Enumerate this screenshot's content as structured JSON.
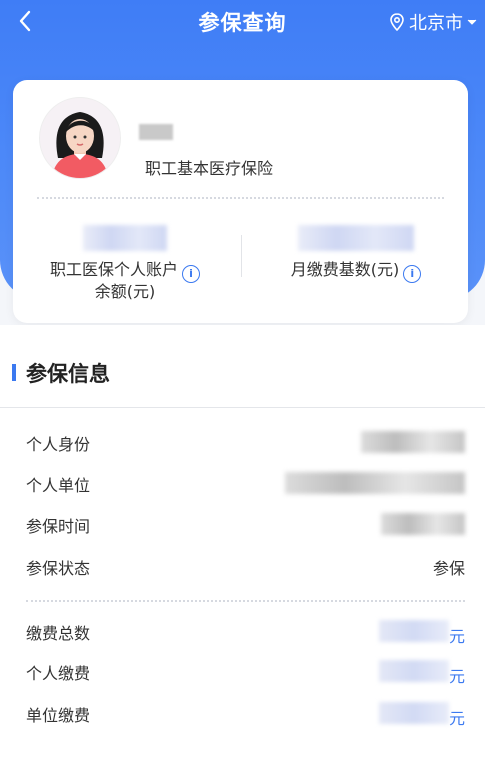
{
  "header": {
    "title": "参保查询",
    "city": "北京市"
  },
  "profile": {
    "insurance_type": "职工基本医疗保险"
  },
  "stats": [
    {
      "label_line1": "职工医保个人账户",
      "label_line2": "余额(元)"
    },
    {
      "label_line1": "月缴费基数(元)"
    }
  ],
  "section": {
    "title": "参保信息"
  },
  "info_rows": [
    {
      "key": "个人身份"
    },
    {
      "key": "个人单位"
    },
    {
      "key": "参保时间"
    },
    {
      "key": "参保状态",
      "value": "参保"
    }
  ],
  "payment_rows": [
    {
      "key": "缴费总数",
      "unit": "元"
    },
    {
      "key": "个人缴费",
      "unit": "元"
    },
    {
      "key": "单位缴费",
      "unit": "元"
    }
  ],
  "colors": {
    "primary": "#3f7df6",
    "accent": "#3b79f0"
  }
}
